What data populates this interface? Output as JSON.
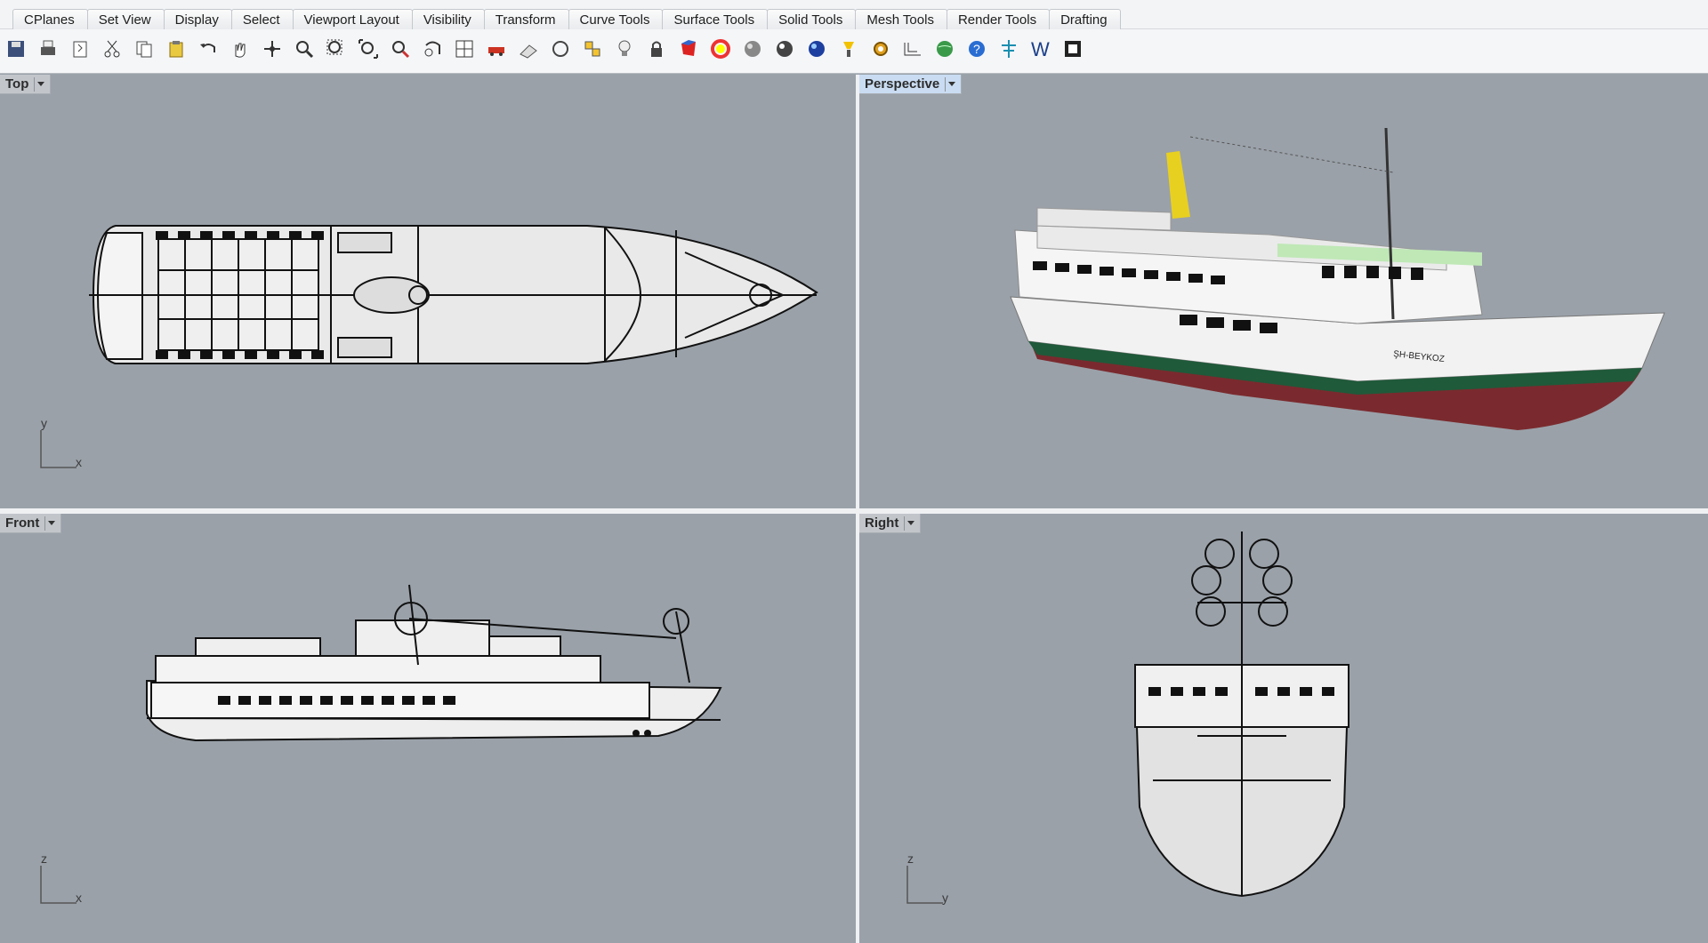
{
  "ribbon": {
    "tabs": [
      "CPlanes",
      "Set View",
      "Display",
      "Select",
      "Viewport Layout",
      "Visibility",
      "Transform",
      "Curve Tools",
      "Surface Tools",
      "Solid Tools",
      "Mesh Tools",
      "Render Tools",
      "Drafting"
    ]
  },
  "toolbar": {
    "icons": [
      "save-icon",
      "print-icon",
      "import-icon",
      "cut-icon",
      "copy-icon",
      "paste-icon",
      "undo-icon",
      "pan-hand-icon",
      "rotate-view-icon",
      "zoom-icon",
      "zoom-window-icon",
      "zoom-extents-icon",
      "zoom-selected-icon",
      "undo-view-icon",
      "four-viewports-icon",
      "car-icon",
      "grid-icon",
      "circle-icon",
      "layers-icon",
      "light-icon",
      "lock-icon",
      "material-icon",
      "color-wheel-icon",
      "shaded-sphere-icon",
      "rendered-sphere-icon",
      "blue-sphere-icon",
      "highlight-icon",
      "settings-gear-icon",
      "dimension-icon",
      "globe-icon",
      "help-icon",
      "tree-icon",
      "w-icon",
      "viewport-frame-icon"
    ]
  },
  "viewports": {
    "top": {
      "title": "Top",
      "axis_h": "x",
      "axis_v": "y"
    },
    "perspective": {
      "title": "Perspective",
      "hull_label": "ŞH-BEYKOZ"
    },
    "front": {
      "title": "Front",
      "axis_h": "x",
      "axis_v": "z"
    },
    "right": {
      "title": "Right",
      "axis_h": "y",
      "axis_v": "z"
    }
  },
  "colors": {
    "viewport_bg": "#9aa1a9",
    "active_title": "#c9dcf2",
    "hull_red": "#7a2a2e",
    "hull_green": "#1f5a3a",
    "funnel_yellow": "#e8d020"
  }
}
